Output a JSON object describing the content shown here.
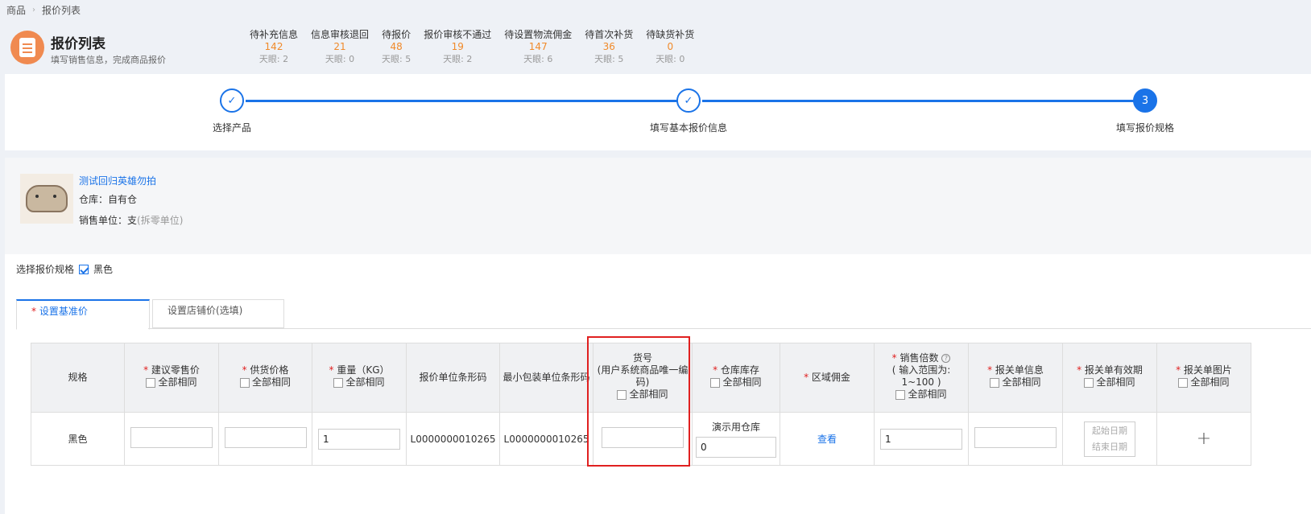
{
  "breadcrumb": {
    "items": [
      "商品",
      "报价列表"
    ]
  },
  "header": {
    "title": "报价列表",
    "subtitle": "填写销售信息，完成商品报价",
    "stats": [
      {
        "label": "待补充信息",
        "count": "142",
        "days": "天眼: 2"
      },
      {
        "label": "信息审核退回",
        "count": "21",
        "days": "天眼: 0"
      },
      {
        "label": "待报价",
        "count": "48",
        "days": "天眼: 5"
      },
      {
        "label": "报价审核不通过",
        "count": "19",
        "days": "天眼: 2"
      },
      {
        "label": "待设置物流佣金",
        "count": "147",
        "days": "天眼: 6"
      },
      {
        "label": "待首次补货",
        "count": "36",
        "days": "天眼: 5"
      },
      {
        "label": "待缺货补货",
        "count": "0",
        "days": "天眼: 0"
      }
    ]
  },
  "steps": [
    {
      "label": "选择产品",
      "mark": "✓"
    },
    {
      "label": "填写基本报价信息",
      "mark": "✓"
    },
    {
      "label": "填写报价规格",
      "mark": "3"
    }
  ],
  "product": {
    "name": "测试回归英雄勿拍",
    "warehouse": "仓库：自有仓",
    "unit_label": "销售单位：支",
    "unit_note": "(拆零单位)"
  },
  "spec": {
    "label": "选择报价规格",
    "option": "黑色",
    "checked": true
  },
  "tabs": [
    {
      "label": "设置基准价",
      "required": true
    },
    {
      "label": "设置店铺价(选填)",
      "required": false
    }
  ],
  "table": {
    "all_same": "全部相同",
    "headers": {
      "spec": "规格",
      "retail_price": "建议零售价",
      "supply_price": "供货价格",
      "weight": "重量（KG）",
      "quote_barcode": "报价单位条形码",
      "min_pack_barcode": "最小包装单位条形码",
      "item_no_line1": "货号",
      "item_no_line2": "(用户系统商品唯一编",
      "item_no_line3": "码)",
      "stock": "仓库库存",
      "region_commission": "区域佣金",
      "sale_multiple": "销售倍数",
      "sale_multiple_range": "( 输入范围为: 1~100 )",
      "customs_info": "报关单信息",
      "customs_validity": "报关单有效期",
      "customs_image": "报关单图片"
    },
    "row": {
      "spec": "黑色",
      "retail_price": "",
      "supply_price": "",
      "weight": "1",
      "quote_barcode": "L0000000010265",
      "min_pack_barcode": "L0000000010265",
      "item_no": "",
      "stock_warehouse": "演示用仓库",
      "stock_value": "0",
      "region_commission": "查看",
      "sale_multiple": "1",
      "customs_info": "",
      "start_date_placeholder": "起始日期",
      "end_date_placeholder": "结束日期",
      "add_symbol": "+"
    }
  }
}
